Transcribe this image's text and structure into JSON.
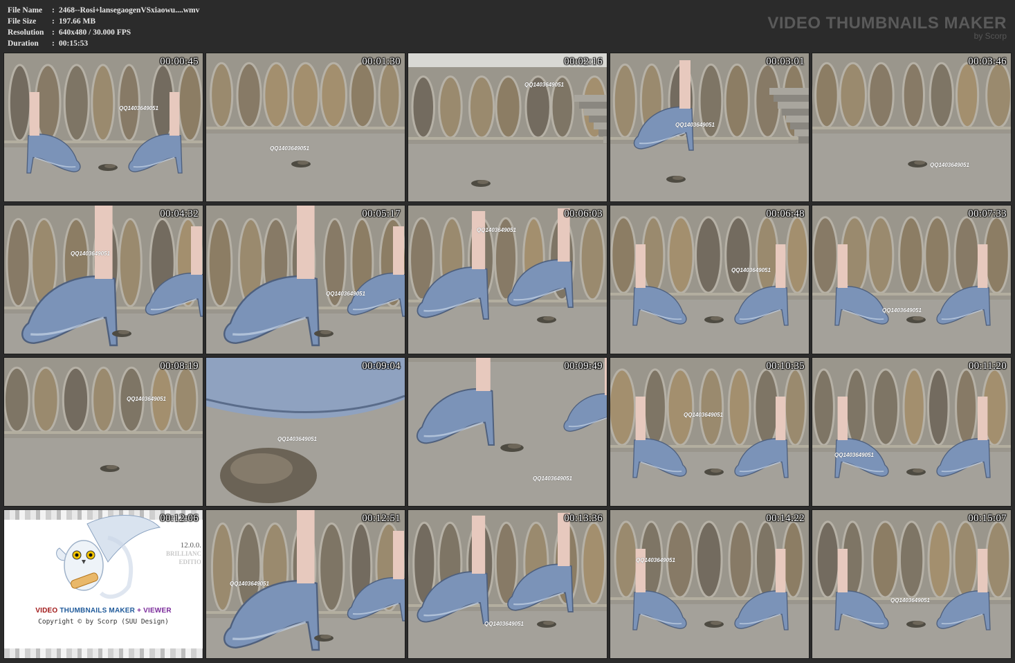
{
  "info": {
    "rows": [
      {
        "label": "File Name",
        "sep": ":",
        "value": "2468--Rosi+lansegaogenVSxiaowu....wmv"
      },
      {
        "label": "File Size",
        "sep": ":",
        "value": "197.66 MB"
      },
      {
        "label": "Resolution",
        "sep": ":",
        "value": "640x480 / 30.000 FPS"
      },
      {
        "label": "Duration",
        "sep": ":",
        "value": "00:15:53"
      }
    ]
  },
  "brand": {
    "title": "VIDEO THUMBNAILS MAKER",
    "subtitle": "by Scorp"
  },
  "promo": {
    "version": "12.0.0.",
    "edition_line1": "BRILLIANC",
    "edition_line2": "EDITIO",
    "title_part1": "VIDEO ",
    "title_part2": "THUMBNAILS MAKER",
    "title_part3": " + VIEWER",
    "copyright": "Copyright © by Scorp (SUU Design)",
    "colors": {
      "part1": "#a01818",
      "part2": "#1f5a9a",
      "part3": "#7a2a9a"
    },
    "icon": "owl-icon"
  },
  "watermark_text": "QQ1403649051",
  "thumbnails": [
    {
      "timestamp": "00:00:45",
      "scene": "feet-wall",
      "wm": true
    },
    {
      "timestamp": "00:01:30",
      "scene": "ground-wall",
      "wm": true
    },
    {
      "timestamp": "00:02:16",
      "scene": "stairs",
      "wm": true
    },
    {
      "timestamp": "00:03:01",
      "scene": "stairs-heel",
      "wm": true
    },
    {
      "timestamp": "00:03:46",
      "scene": "ground-wall",
      "wm": true
    },
    {
      "timestamp": "00:04:32",
      "scene": "shoe-close",
      "wm": true
    },
    {
      "timestamp": "00:05:17",
      "scene": "shoe-close",
      "wm": true
    },
    {
      "timestamp": "00:06:03",
      "scene": "heels",
      "wm": true
    },
    {
      "timestamp": "00:06:48",
      "scene": "feet-wall",
      "wm": true
    },
    {
      "timestamp": "00:07:33",
      "scene": "feet-wall",
      "wm": true
    },
    {
      "timestamp": "00:08:19",
      "scene": "ground-wall",
      "wm": true
    },
    {
      "timestamp": "00:09:04",
      "scene": "ground-close",
      "wm": true
    },
    {
      "timestamp": "00:09:49",
      "scene": "heels-ground",
      "wm": true
    },
    {
      "timestamp": "00:10:35",
      "scene": "feet-wall",
      "wm": true
    },
    {
      "timestamp": "00:11:20",
      "scene": "feet-wall",
      "wm": true
    },
    {
      "timestamp": "00:12:06",
      "scene": "promo",
      "wm": false
    },
    {
      "timestamp": "00:12:51",
      "scene": "shoe-close",
      "wm": true
    },
    {
      "timestamp": "00:13:36",
      "scene": "heels",
      "wm": true
    },
    {
      "timestamp": "00:14:22",
      "scene": "feet-wall",
      "wm": true
    },
    {
      "timestamp": "00:15:07",
      "scene": "feet-wall",
      "wm": true
    }
  ]
}
